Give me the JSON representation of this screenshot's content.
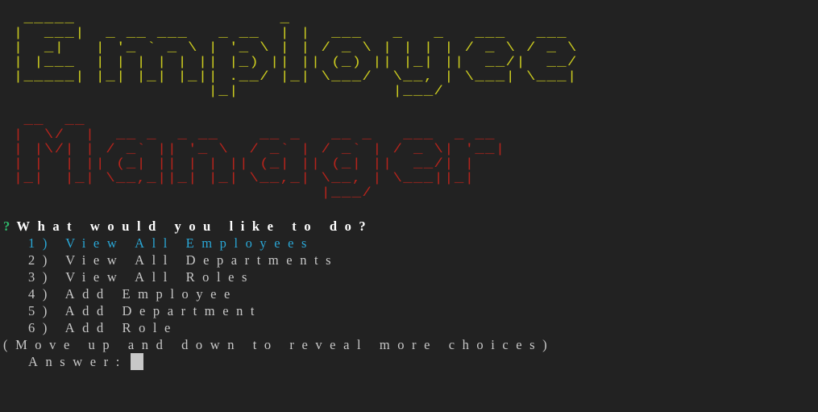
{
  "banner": {
    "employee_art": "  _____                    _                            \n |  ___|  _ __ ___   _ __  | |  ___   _   _   ___   ___ \n |  _|   | '_ ` _ \\ | '_ \\ | | / _ \\ | | | | / _ \\ / _ \\\n | |___  | | | | | || |_) || || (_) || |_| ||  __/|  __/\n |_____| |_| |_| |_|| .__/ |_| \\___/  \\__, | \\___| \\___|\n                    |_|               |___/             ",
    "manager_art": "  __  __                                              \n |  \\/  |  __ _  _ __    __ _   __ _   ___  _ __       \n | |\\/| | / _` || '_ \\  / _` | / _` | / _ \\| '__|      \n | |  | || (_| || | | || (_| || (_| ||  __/| |         \n |_|  |_| \\__,_||_| |_| \\__,_| \\__, | \\___||_|         \n                               |___/                   ",
    "employee_color": "#c8c820",
    "manager_color": "#b3241c"
  },
  "prompt": {
    "marker": "?",
    "question": "What would you like to do?",
    "choices": [
      {
        "label": "1) View All Employees",
        "selected": true
      },
      {
        "label": "2) View All Departments",
        "selected": false
      },
      {
        "label": "3) View All Roles",
        "selected": false
      },
      {
        "label": "4) Add Employee",
        "selected": false
      },
      {
        "label": "5) Add Department",
        "selected": false
      },
      {
        "label": "6) Add Role",
        "selected": false
      }
    ],
    "hint": "(Move up and down to reveal more choices)",
    "answer_label": "Answer:",
    "answer_value": ""
  },
  "colors": {
    "background": "#222222",
    "marker": "#2fb86a",
    "selected": "#2aa7d6",
    "text": "#c8c8c8",
    "question": "#ffffff"
  }
}
